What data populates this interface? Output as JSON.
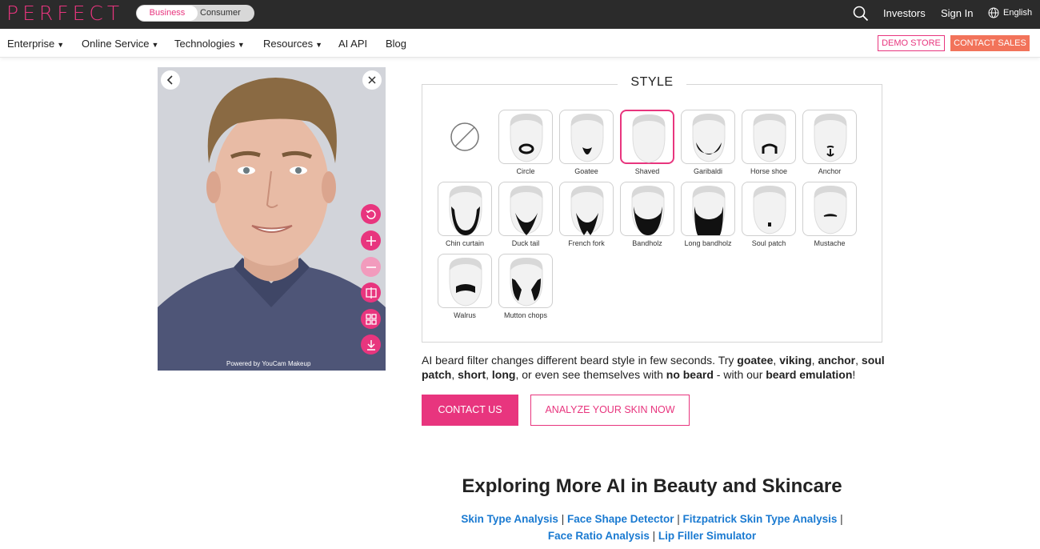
{
  "brand": {
    "logo": "PERFECT"
  },
  "segment": {
    "business": "Business",
    "consumer": "Consumer"
  },
  "topbar": {
    "investors": "Investors",
    "sign_in": "Sign In",
    "language": "English"
  },
  "nav": {
    "items": [
      "Enterprise",
      "Online Service",
      "Technologies",
      "Resources",
      "AI API",
      "Blog"
    ],
    "demo_store": "DEMO STORE",
    "contact_sales": "CONTACT SALES"
  },
  "photo": {
    "powered_by": "Powered by YouCam Makeup"
  },
  "style": {
    "title": "STYLE",
    "selected": "Shaved",
    "rows": [
      [
        "Circle",
        "Goatee",
        "Shaved",
        "Garibaldi",
        "Horse shoe",
        "Anchor"
      ],
      [
        "Chin curtain",
        "Duck tail",
        "French fork",
        "Bandholz",
        "Long bandholz",
        "Soul patch",
        "Mustache"
      ],
      [
        "Walrus",
        "Mutton chops"
      ]
    ]
  },
  "description": {
    "t1": "AI beard filter changes different beard style in few seconds. Try ",
    "k1": "goatee",
    "t2": ", ",
    "k2": "viking",
    "t3": ", ",
    "k3": "anchor",
    "t4": ", ",
    "k4": "soul patch",
    "t5": ", ",
    "k5": "short",
    "t6": ", ",
    "k6": "long",
    "t7": ", or even see themselves with ",
    "k7": "no beard",
    "t8": " - with our ",
    "k8": "beard emulation",
    "t9": "!"
  },
  "buttons": {
    "contact_us": "CONTACT US",
    "analyze": "ANALYZE YOUR SKIN NOW"
  },
  "explore": {
    "title": "Exploring More AI in Beauty and Skincare",
    "links": [
      "Skin Type Analysis",
      "Face Shape Detector",
      "Fitzpatrick Skin Type Analysis",
      "Face Ratio Analysis",
      "Lip Filler Simulator"
    ],
    "separator": " | "
  },
  "colors": {
    "brand_pink": "#e8357e",
    "sales_orange": "#f2735a",
    "link_blue": "#1a7ad1",
    "topbar": "#2b2b2b"
  }
}
